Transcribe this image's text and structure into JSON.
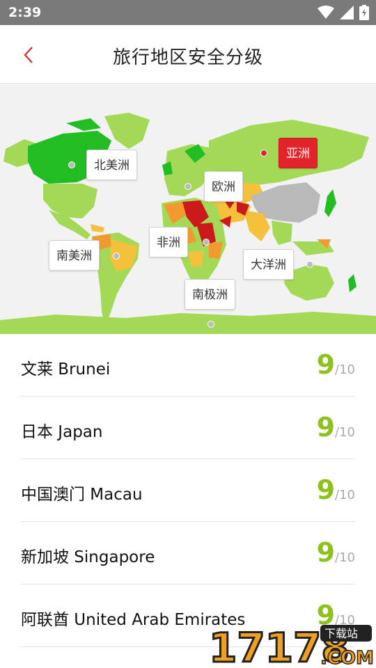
{
  "status_bar": {
    "time": "2:39"
  },
  "header": {
    "title": "旅行地区安全分级"
  },
  "colors": {
    "accent": "#e2232a",
    "score_green": "#8cc21a"
  },
  "map": {
    "regions": [
      {
        "key": "north_america",
        "label": "北美洲",
        "active": false
      },
      {
        "key": "europe",
        "label": "欧洲",
        "active": false
      },
      {
        "key": "asia",
        "label": "亚洲",
        "active": true
      },
      {
        "key": "africa",
        "label": "非洲",
        "active": false
      },
      {
        "key": "south_america",
        "label": "南美洲",
        "active": false
      },
      {
        "key": "oceania",
        "label": "大洋洲",
        "active": false
      },
      {
        "key": "antarctica",
        "label": "南极洲",
        "active": false
      }
    ]
  },
  "countries": [
    {
      "name": "文莱 Brunei",
      "score": "9",
      "max": "/10"
    },
    {
      "name": "日本 Japan",
      "score": "9",
      "max": "/10"
    },
    {
      "name": "中国澳门 Macau",
      "score": "9",
      "max": "/10"
    },
    {
      "name": "新加坡 Singapore",
      "score": "9",
      "max": "/10"
    },
    {
      "name": "阿联酋 United Arab Emirates",
      "score": "9",
      "max": "/10"
    }
  ],
  "watermark": {
    "text": "17178",
    "badge": "下载站",
    "suffix": ".COM"
  }
}
